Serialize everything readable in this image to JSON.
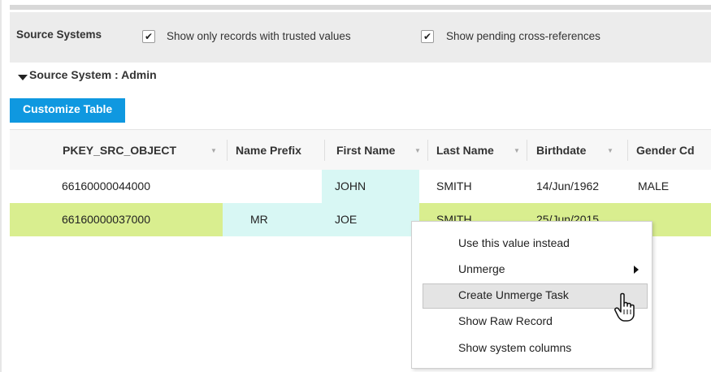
{
  "toolbar": {
    "title": "Source Systems",
    "checkboxes": [
      {
        "label": "Show only records with trusted values",
        "checked": true
      },
      {
        "label": "Show pending cross-references",
        "checked": true
      }
    ]
  },
  "section": {
    "title": "Source System : Admin"
  },
  "customize_button": "Customize Table",
  "table": {
    "columns": [
      "PKEY_SRC_OBJECT",
      "Name Prefix",
      "First Name",
      "Last Name",
      "Birthdate",
      "Gender Cd"
    ],
    "rows": [
      [
        "66160000044000",
        "",
        "JOHN",
        "SMITH",
        "14/Jun/1962",
        "MALE"
      ],
      [
        "66160000037000",
        "MR",
        "JOE",
        "SMITH",
        "25/Jun/2015",
        ""
      ]
    ]
  },
  "context_menu": {
    "items": [
      "Use this value instead",
      "Unmerge",
      "Create Unmerge Task",
      "Show Raw Record",
      "Show system columns"
    ],
    "highlighted": "Create Unmerge Task"
  },
  "icons": {
    "checkbox": "checkmark-icon",
    "section_toggle": "triangle-down-icon",
    "sort": "sort-arrow-icon",
    "submenu": "chevron-right-icon",
    "cursor": "hand-pointer-icon"
  },
  "colors": {
    "button": "#0f98e0",
    "selected_row": "#d9ee8f",
    "trusted_cell": "#d8f7f4",
    "menu_highlight": "#e4e4e4"
  }
}
